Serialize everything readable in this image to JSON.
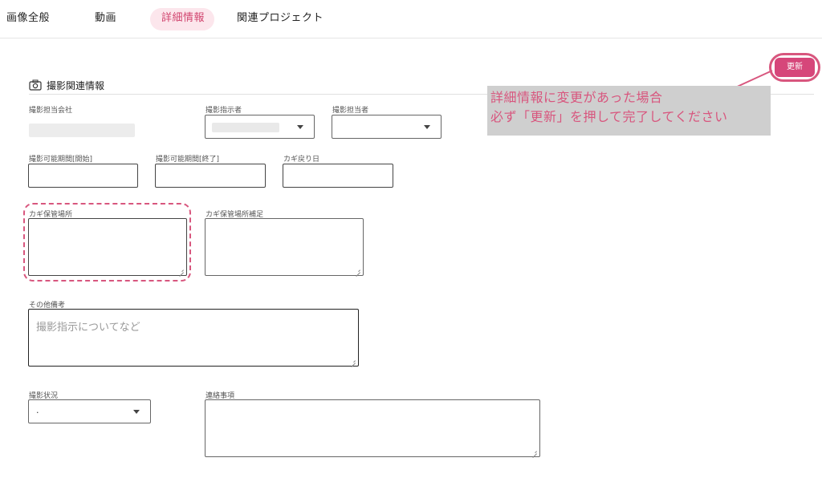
{
  "tabs": [
    {
      "label": "画像全般"
    },
    {
      "label": "動画"
    },
    {
      "label": "詳細情報"
    },
    {
      "label": "関連プロジェクト"
    }
  ],
  "toolbar": {
    "update_label": "更新"
  },
  "section": {
    "title": "撮影関連情報",
    "icon": "camera-icon"
  },
  "fields": {
    "company": {
      "label": "撮影担当会社"
    },
    "instructor": {
      "label": "撮影指示者"
    },
    "person": {
      "label": "撮影担当者"
    },
    "period_start": {
      "label": "撮影可能期間[開始]"
    },
    "period_end": {
      "label": "撮影可能期間[終了]"
    },
    "key_return": {
      "label": "カギ戻り日"
    },
    "key_location": {
      "label": "カギ保管場所"
    },
    "key_location_note": {
      "label": "カギ保管場所補足"
    },
    "other_notes": {
      "label": "その他備考",
      "placeholder": "撮影指示についてなど"
    },
    "status": {
      "label": "撮影状況",
      "value": "."
    },
    "contact": {
      "label": "連絡事項"
    }
  },
  "annotation": {
    "line1": "詳細情報に変更があった場合",
    "line2": "必ず「更新」を押して完了してください"
  },
  "colors": {
    "accent": "#d6467a",
    "highlight": "#d8567e",
    "active_tab_bg": "#fce6ec"
  }
}
